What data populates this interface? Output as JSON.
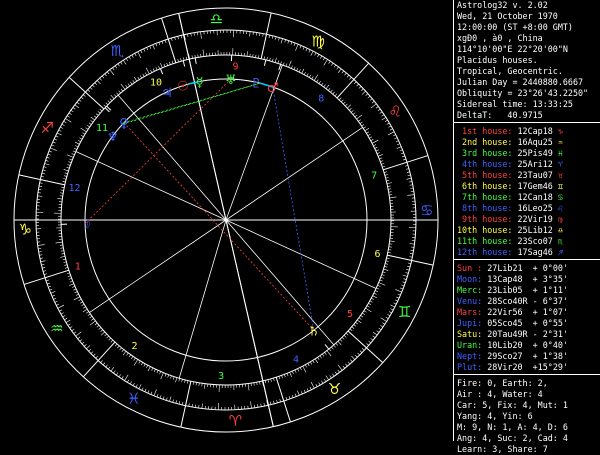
{
  "header_lines": [
    "Astrolog32 v. 2.02",
    "Wed, 21 October 1970",
    "12:00:00 (ST +8:00 GMT)",
    "xgÐ0 , à0 , China",
    "114°10'00\"E 22°20'00\"N",
    "Placidus houses.",
    "Tropical, Geocentric.",
    "Julian Day = 2440880.6667",
    "Obliquity = 23°26'43.2250\"",
    "Sidereal time: 13:33:25",
    "DeltaT:   40.9715"
  ],
  "houses": [
    {
      "label": "1st house:",
      "value": "12Cap18",
      "color": "#ff4040"
    },
    {
      "label": "2nd house:",
      "value": "16Aqu25",
      "color": "#ffff40"
    },
    {
      "label": "3rd house:",
      "value": "25Pis49",
      "color": "#40ff40"
    },
    {
      "label": "4th house:",
      "value": "25Ari12",
      "color": "#4060ff"
    },
    {
      "label": "5th house:",
      "value": "23Tau07",
      "color": "#ff4040"
    },
    {
      "label": "6th house:",
      "value": "17Gem46",
      "color": "#ffff40"
    },
    {
      "label": "7th house:",
      "value": "12Can18",
      "color": "#40ff40"
    },
    {
      "label": "8th house:",
      "value": "16Leo25",
      "color": "#4060ff"
    },
    {
      "label": "9th house:",
      "value": "22Vir19",
      "color": "#ff4040"
    },
    {
      "label": "10th house:",
      "value": "25Lib12",
      "color": "#ffff40"
    },
    {
      "label": "11th house:",
      "value": "23Sco07",
      "color": "#40ff40"
    },
    {
      "label": "12th house:",
      "value": "17Sag46",
      "color": "#4060ff"
    }
  ],
  "house_glyphs": [
    "♑",
    "♒",
    "♓",
    "♈",
    "♉",
    "♊",
    "♋",
    "♌",
    "♍",
    "♎",
    "♏",
    "♐"
  ],
  "planets": [
    {
      "name": "Sun :",
      "pos": "27Lib21",
      "lat": "+ 0°00'",
      "color": "#ff4040"
    },
    {
      "name": "Moon:",
      "pos": "13Cap48",
      "lat": "+ 3°35'",
      "color": "#4060ff"
    },
    {
      "name": "Merc:",
      "pos": "23Lib05",
      "lat": "+ 1°11'",
      "color": "#40ff40"
    },
    {
      "name": "Venu:",
      "pos": "28Sco40R",
      "lat": "- 6°37'",
      "color": "#4060ff"
    },
    {
      "name": "Mars:",
      "pos": "22Vir56",
      "lat": "+ 1°07'",
      "color": "#ff4040"
    },
    {
      "name": "Jupi:",
      "pos": "05Sco45",
      "lat": "+ 0°55'",
      "color": "#4060ff"
    },
    {
      "name": "Satu:",
      "pos": "20Tau49R",
      "lat": "- 2°31'",
      "color": "#ffff40"
    },
    {
      "name": "Uran:",
      "pos": "10Lib20",
      "lat": "+ 0°40'",
      "color": "#40ff40"
    },
    {
      "name": "Nept:",
      "pos": "29Sco27",
      "lat": "+ 1°38'",
      "color": "#4060ff"
    },
    {
      "name": "Plut:",
      "pos": "28Vir20",
      "lat": "+15°29'",
      "color": "#4060ff"
    }
  ],
  "summary_lines": [
    "Fire: 0, Earth: 2,",
    "Air : 4, Water: 4",
    "Car: 5, Fix: 4, Mut: 1",
    "Yang: 4, Yin: 6",
    "M: 9, N: 1, A: 4, D: 6",
    "Ang: 4, Suc: 2, Cad: 4",
    "Learn: 3, Share: 7"
  ],
  "wheel": {
    "asc": "12Cap18",
    "mc": "25Lib12",
    "sign_glyphs": [
      "♈",
      "♉",
      "♊",
      "♋",
      "♌",
      "♍",
      "♎",
      "♏",
      "♐",
      "♑",
      "♒",
      "♓"
    ],
    "sign_colors": [
      "#ff4040",
      "#ffff40",
      "#40ff40",
      "#4060ff",
      "#ff4040",
      "#ffff40",
      "#40ff40",
      "#4060ff",
      "#ff4040",
      "#ffff40",
      "#40ff40",
      "#4060ff"
    ],
    "house_numbers": [
      "1",
      "2",
      "3",
      "4",
      "5",
      "6",
      "7",
      "8",
      "9",
      "10",
      "11",
      "12"
    ],
    "house_number_colors": [
      "#ff4040",
      "#ffff40",
      "#40ff40",
      "#4060ff",
      "#ff4040",
      "#ffff40",
      "#40ff40",
      "#4060ff",
      "#ff4040",
      "#ffff40",
      "#40ff40",
      "#4060ff"
    ],
    "planet_glyphs": [
      {
        "glyph": "☉",
        "color": "#ff4040"
      },
      {
        "glyph": "☽",
        "color": "#4060ff"
      },
      {
        "glyph": "☿",
        "color": "#40ff40"
      },
      {
        "glyph": "♀",
        "color": "#4060ff"
      },
      {
        "glyph": "♂",
        "color": "#ff4040"
      },
      {
        "glyph": "♃",
        "color": "#4060ff"
      },
      {
        "glyph": "♄",
        "color": "#ffff40"
      },
      {
        "glyph": "♅",
        "color": "#40ff40"
      },
      {
        "glyph": "♆",
        "color": "#4060ff"
      },
      {
        "glyph": "♇",
        "color": "#4060ff"
      }
    ],
    "line_colors": {
      "bright": "#00c8ff",
      "trine": "#4060ff",
      "square": "#ff4040",
      "sextile": "#40ff40"
    }
  }
}
